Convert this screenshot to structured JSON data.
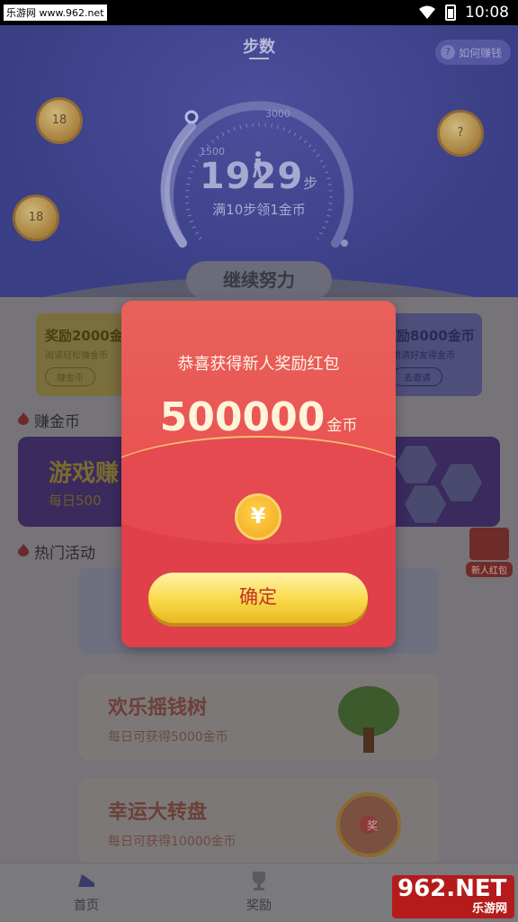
{
  "status_bar": {
    "site_watermark": "乐游网 www.962.net",
    "time": "10:08"
  },
  "header": {
    "title": "步数",
    "how_to_earn": "如何赚钱",
    "coins": [
      "18",
      "18",
      "?"
    ],
    "gauge": {
      "label_low": "1500",
      "label_high": "3000",
      "steps": "1929",
      "unit": "步",
      "hint": "满10步领1金币"
    },
    "continue_button": "继续努力"
  },
  "reward_cards": [
    {
      "title": "奖励2000金币",
      "subtitle": "阅读轻松赚金币",
      "button": "赚金币"
    },
    {
      "title": "奖励8000金币",
      "subtitle": "邀请好友得金币",
      "button": "去邀请"
    }
  ],
  "sections": {
    "earn_coins": "赚金币",
    "hot_activities": "热门活动"
  },
  "game_banner": {
    "title": "游戏赚",
    "subtitle": "每日500"
  },
  "new_redpack_badge": "新人红包",
  "activities": [
    {
      "title": "欢乐摇钱树",
      "subtitle": "每日可获得5000金币"
    },
    {
      "title": "幸运大转盘",
      "subtitle": "每日可获得10000金币",
      "wheel_text": "奖"
    }
  ],
  "bottom_nav": [
    {
      "label": "首页",
      "icon": "shoe-icon"
    },
    {
      "label": "奖励",
      "icon": "trophy-icon"
    }
  ],
  "bottom_watermark": {
    "brand": "962.NET",
    "sub": "乐游网"
  },
  "modal": {
    "title": "恭喜获得新人奖励红包",
    "amount": "500000",
    "unit": "金币",
    "coin_symbol": "¥",
    "confirm_button": "确定"
  },
  "colors": {
    "modal_red": "#e04048",
    "button_yellow": "#f9d94a",
    "header_blue": "#3b3f86"
  }
}
